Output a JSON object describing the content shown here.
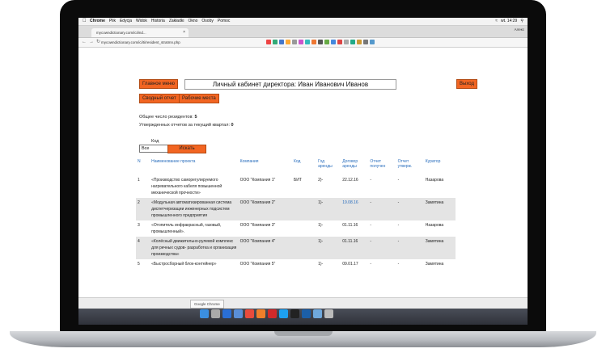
{
  "mac_menubar": {
    "items": [
      "Chrome",
      "Plik",
      "Edycja",
      "Widok",
      "Historia",
      "Zakładki",
      "Okno",
      "Osoby",
      "Pomoc"
    ],
    "clock": "wt. 14:29"
  },
  "browser": {
    "tab_title": "mycowndictionary.com/ici/ind...",
    "user_name": "Алекс",
    "url": "mycowndictionary.com/ici/ti/resident_stratmn.php",
    "download_item": "Google Chrome"
  },
  "header": {
    "main_menu": "Главное меню",
    "title": "Личный кабинет директора: Иван Иванович Иванов",
    "logout": "Выход",
    "summary_report": "Сводный отчет",
    "workplaces": "Рабочие места"
  },
  "stats": {
    "residents_label": "Общее число резидентов:",
    "residents_value": "5",
    "reports_label": "Утвержденных отчетов за текущий квартал:",
    "reports_value": "0"
  },
  "filter": {
    "code_label": "Код",
    "code_value": "Все",
    "search_button": "Искать"
  },
  "table": {
    "headers": [
      "N",
      "Наименование проекта",
      "Компания",
      "Код",
      "Год аренды",
      "Договор аренды",
      "Отчет получен",
      "Отчет утверж.",
      "Куратор"
    ],
    "rows": [
      {
        "n": "1",
        "project": "«Производство саморегулируемого нагревательного кабеля повышенной механической прочности»",
        "company": "ООО \"Компания 1\"",
        "code": "БИТ",
        "year": "2)-",
        "contract": "22.12.16",
        "received": "-",
        "approved": "-",
        "curator": "Назарова"
      },
      {
        "n": "2",
        "project": "«Модульная автоматизированная система диспетчеризации инженерных подсистем промышленного предприятия",
        "company": "ООО \"Компания 2\"",
        "code": "",
        "year": "1)-",
        "contract": "19.08.16",
        "received": "-",
        "approved": "-",
        "curator": "Замятина"
      },
      {
        "n": "3",
        "project": "«Отопитель инфракрасный, газовый, промышленный».",
        "company": "ООО \"Компания 3\"",
        "code": "",
        "year": "1)-",
        "contract": "01.11.16",
        "received": "-",
        "approved": "-",
        "curator": "Назарова"
      },
      {
        "n": "4",
        "project": "«Колёсный движительно-рулевой комплекс для речных судов- разработка и организация производства»",
        "company": "ООО \"Компания 4\"",
        "code": "",
        "year": "1)-",
        "contract": "01.11.16",
        "received": "-",
        "approved": "-",
        "curator": "Замятина"
      },
      {
        "n": "5",
        "project": "«Быстросборный блок-контейнер»",
        "company": "ООО \"Компания 5\"",
        "code": "",
        "year": "1)-",
        "contract": "09.01.17",
        "received": "-",
        "approved": "-",
        "curator": "Замятина"
      }
    ]
  },
  "colors": {
    "accent": "#f26522",
    "link": "#2a6ebd",
    "row_alt": "#e4e4e4"
  },
  "dock_icons": [
    "finder-icon",
    "launchpad-icon",
    "safari-icon",
    "mail-icon",
    "chrome-icon",
    "firefox-icon",
    "opera-icon",
    "skype-icon",
    "terminal-icon",
    "photoshop-icon",
    "folder-icon",
    "trash-icon"
  ]
}
